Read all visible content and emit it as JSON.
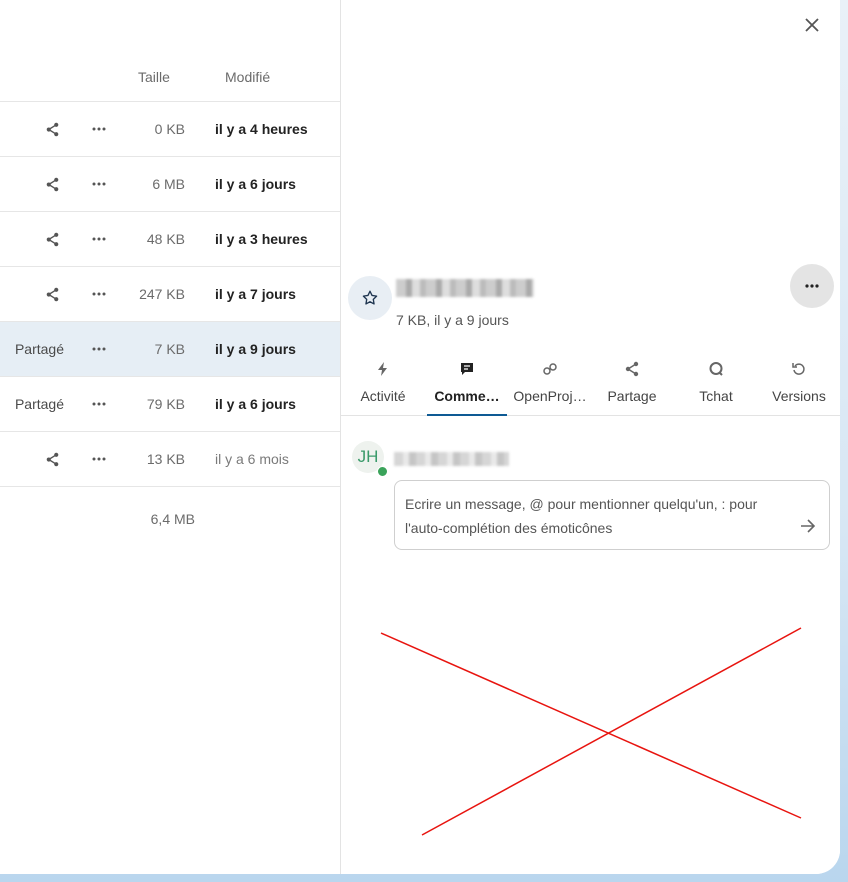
{
  "file_list": {
    "headers": {
      "size": "Taille",
      "modified": "Modifié"
    },
    "rows": [
      {
        "shared": "",
        "size": "0 KB",
        "modified": "il y a 4 heures",
        "selected": false
      },
      {
        "shared": "",
        "size": "6 MB",
        "modified": "il y a 6 jours",
        "selected": false
      },
      {
        "shared": "",
        "size": "48 KB",
        "modified": "il y a 3 heures",
        "selected": false
      },
      {
        "shared": "",
        "size": "247 KB",
        "modified": "il y a 7 jours",
        "selected": false
      },
      {
        "shared": "Partagé",
        "size": "7 KB",
        "modified": "il y a 9 jours",
        "selected": true
      },
      {
        "shared": "Partagé",
        "size": "79 KB",
        "modified": "il y a 6 jours",
        "selected": false
      },
      {
        "shared": "",
        "size": "13 KB",
        "modified": "il y a 6 mois",
        "selected": false
      }
    ],
    "total_size": "6,4 MB"
  },
  "sidebar": {
    "file_meta": "7 KB, il y a 9 jours",
    "tabs": [
      {
        "label": "Activité",
        "icon": "activity-icon"
      },
      {
        "label": "Comme…",
        "icon": "comment-icon",
        "active": true
      },
      {
        "label": "OpenProj…",
        "icon": "link-icon"
      },
      {
        "label": "Partage",
        "icon": "share-icon"
      },
      {
        "label": "Tchat",
        "icon": "chat-icon"
      },
      {
        "label": "Versions",
        "icon": "history-icon"
      }
    ],
    "comments": {
      "avatar_initials": "JH",
      "placeholder": "Ecrire un message, @ pour mentionner quelqu'un, : pour l'auto-complétion des émoticônes"
    }
  },
  "colors": {
    "active_tab": "#0e5a94",
    "selected_row": "#e6eef5",
    "online": "#3aa35a",
    "cross": "#e8140f"
  }
}
